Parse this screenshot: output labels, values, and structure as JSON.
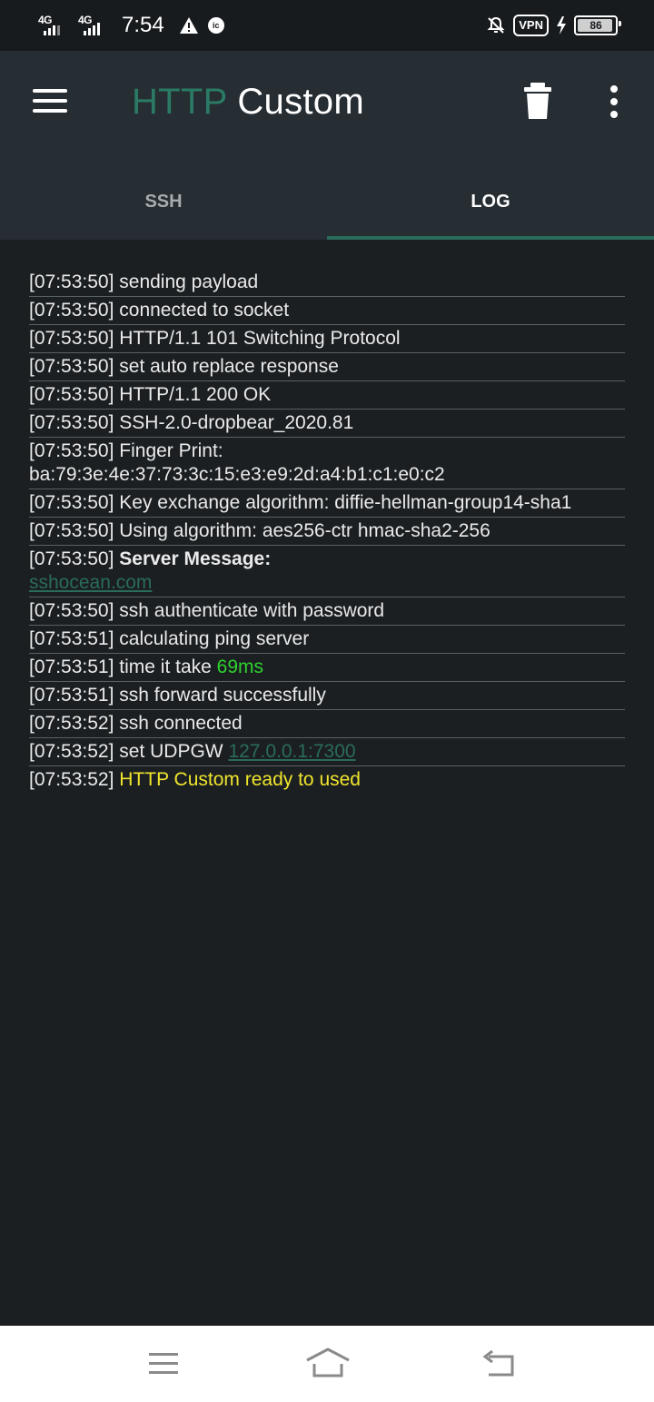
{
  "status": {
    "net1": "4G",
    "net2": "4G",
    "time": "7:54",
    "notif_icon": "ic",
    "vpn": "VPN",
    "battery_level": "86",
    "battery_fraction": 0.86
  },
  "app": {
    "title_part1": "HTTP",
    "title_part2": "Custom",
    "accent": "#2a6b5b"
  },
  "tabs": [
    {
      "label": "SSH",
      "active": false
    },
    {
      "label": "LOG",
      "active": true
    }
  ],
  "log": [
    {
      "ts": "[07:53:50]",
      "text": "sending payload"
    },
    {
      "ts": "[07:53:50]",
      "text": "connected to socket"
    },
    {
      "ts": "[07:53:50]",
      "text": "HTTP/1.1 101 Switching Protocol"
    },
    {
      "ts": "[07:53:50]",
      "text": "set auto replace response"
    },
    {
      "ts": "[07:53:50]",
      "text": "HTTP/1.1 200 OK"
    },
    {
      "ts": "[07:53:50]",
      "text": "SSH-2.0-dropbear_2020.81"
    },
    {
      "ts": "[07:53:50]",
      "text": "Finger Print:",
      "line2": "ba:79:3e:4e:37:73:3c:15:e3:e9:2d:a4:b1:c1:e0:c2"
    },
    {
      "ts": "[07:53:50]",
      "text": "Key exchange algorithm: diffie-hellman-group14-sha1"
    },
    {
      "ts": "[07:53:50]",
      "text": "Using algorithm: aes256-ctr hmac-sha2-256"
    },
    {
      "ts": "[07:53:50]",
      "bold": "Server Message:",
      "link_line2": "sshocean.com"
    },
    {
      "ts": "[07:53:50]",
      "text": "ssh authenticate with password"
    },
    {
      "ts": "[07:53:51]",
      "text": "calculating ping server"
    },
    {
      "ts": "[07:53:51]",
      "text": "time it take",
      "ok": "69ms"
    },
    {
      "ts": "[07:53:51]",
      "text": "ssh forward successfully"
    },
    {
      "ts": "[07:53:52]",
      "text": "ssh connected"
    },
    {
      "ts": "[07:53:52]",
      "text": "set UDPGW",
      "link": "127.0.0.1:7300"
    },
    {
      "ts": "[07:53:52]",
      "ready": "HTTP Custom ready to used",
      "no_border": true
    }
  ]
}
